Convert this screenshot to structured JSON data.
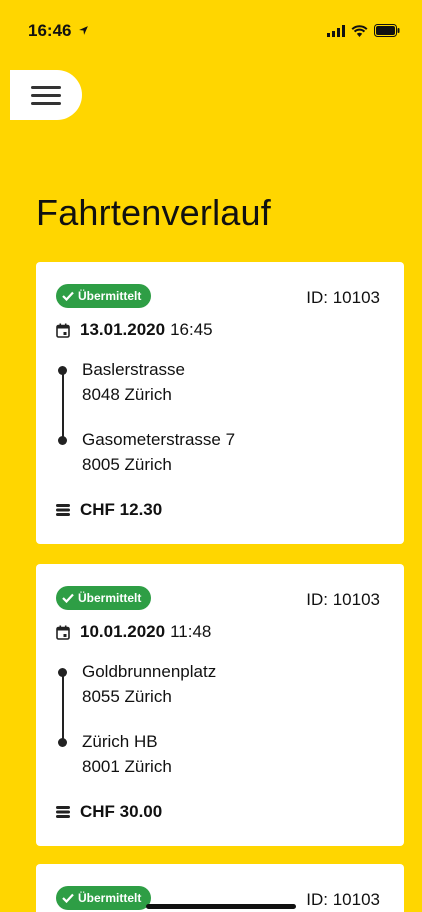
{
  "status_bar": {
    "time": "16:46"
  },
  "page": {
    "title": "Fahrtenverlauf"
  },
  "rides": [
    {
      "status": "Übermittelt",
      "id": "ID: 10103",
      "date": "13.01.2020",
      "time": "16:45",
      "from_street": "Baslerstrasse",
      "from_city": "8048 Zürich",
      "to_street": "Gasometerstrasse 7",
      "to_city": "8005 Zürich",
      "price": "CHF 12.30"
    },
    {
      "status": "Übermittelt",
      "id": "ID: 10103",
      "date": "10.01.2020",
      "time": "11:48",
      "from_street": "Goldbrunnenplatz",
      "from_city": "8055 Zürich",
      "to_street": "Zürich HB",
      "to_city": "8001 Zürich",
      "price": "CHF 30.00"
    },
    {
      "status": "Übermittelt",
      "id": "ID: 10103"
    }
  ],
  "colors": {
    "background": "#FFD600",
    "badge": "#2E9E45",
    "card": "#FFFFFF"
  },
  "icons": [
    "location-arrow-icon",
    "signal-icon",
    "wifi-icon",
    "battery-icon",
    "menu-icon",
    "check-icon",
    "calendar-icon",
    "coins-icon"
  ]
}
